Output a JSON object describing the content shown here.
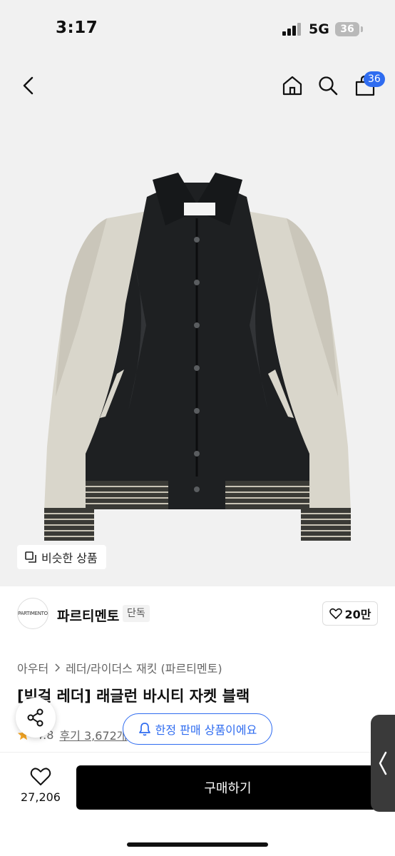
{
  "status": {
    "time": "3:17",
    "network": "5G",
    "battery": "36"
  },
  "nav": {
    "cart_badge": "36"
  },
  "hero": {
    "similar_label": "비슷한 상품"
  },
  "brand": {
    "logo_text": "PARTIMENTO",
    "name": "파르티멘토",
    "tag": "단독",
    "likes": "20만"
  },
  "product": {
    "breadcrumb": [
      "아우터",
      "레더/라이더스 재킷 (파르티멘토)"
    ],
    "title": "[빅걸 레더] 래글런 바시티 자켓 블랙",
    "rating": "4.8",
    "reviews": "후기 3,672개"
  },
  "toast": {
    "limited": "한정 판매 상품이에요"
  },
  "bottom": {
    "wish_count": "27,206",
    "buy_label": "구매하기"
  },
  "colors": {
    "accent": "#2f6cf0",
    "buy": "#000000",
    "star": "#f5a623"
  },
  "icons": [
    "back-icon",
    "home-icon",
    "search-icon",
    "cart-icon",
    "similar-icon",
    "heart-icon",
    "share-icon",
    "bell-icon",
    "star-icon",
    "chevron-left-icon"
  ]
}
